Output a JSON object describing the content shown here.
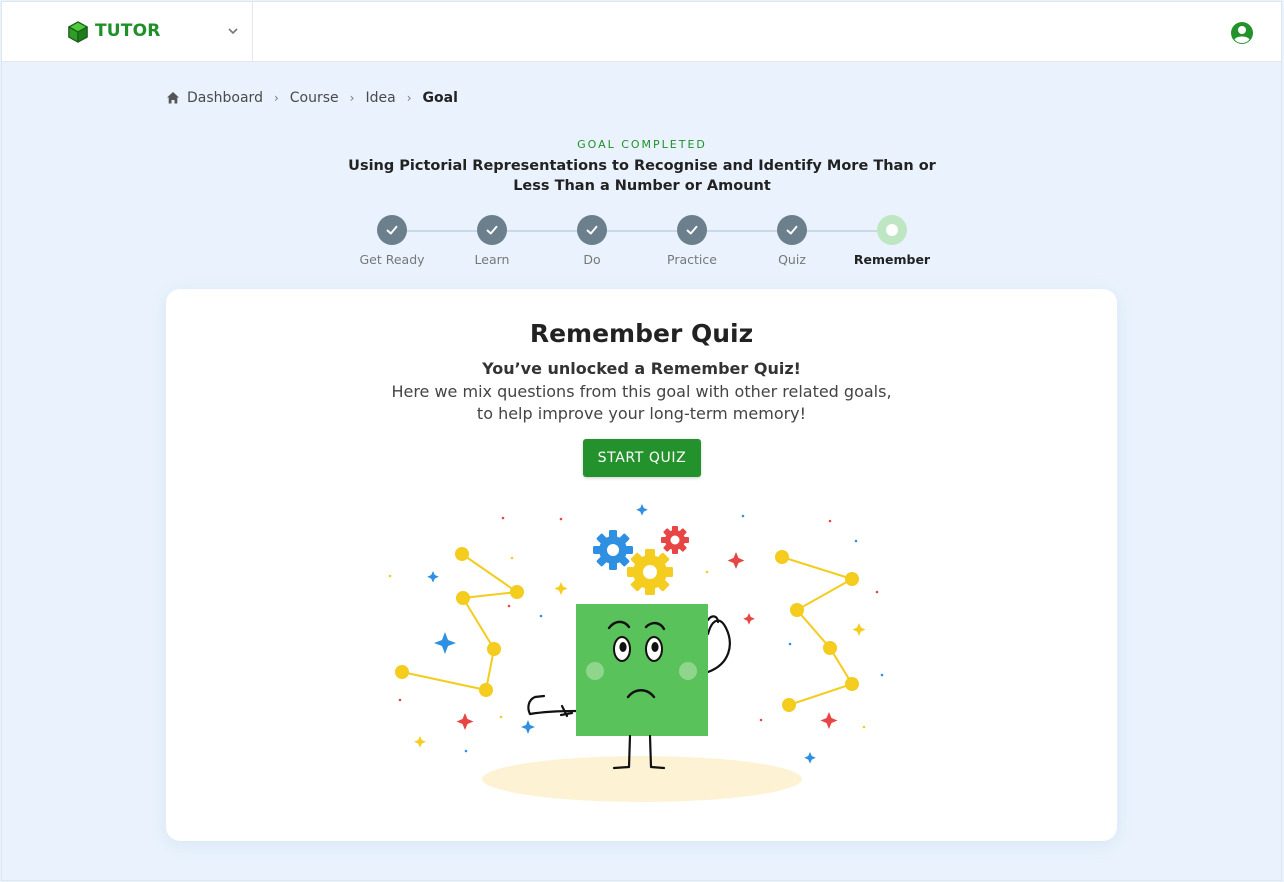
{
  "app": {
    "brand": "TUTOR"
  },
  "icons": {
    "logo": "cube-icon",
    "menu": "chevron-down-icon",
    "account": "account-circle-icon",
    "home": "home-icon",
    "separator": "chevron-right-icon",
    "done": "check-icon"
  },
  "colors": {
    "brand_green": "#23922c",
    "page_bg": "#eaf3fd",
    "step_done": "#6b7f8c",
    "step_current": "#bfe6c3"
  },
  "breadcrumb": [
    {
      "label": "Dashboard"
    },
    {
      "label": "Course"
    },
    {
      "label": "Idea"
    },
    {
      "label": "Goal"
    }
  ],
  "goal": {
    "status": "GOAL COMPLETED",
    "title": "Using Pictorial Representations to Recognise and Identify More Than or Less Than a Number or Amount"
  },
  "steps": [
    {
      "label": "Get Ready",
      "state": "done"
    },
    {
      "label": "Learn",
      "state": "done"
    },
    {
      "label": "Do",
      "state": "done"
    },
    {
      "label": "Practice",
      "state": "done"
    },
    {
      "label": "Quiz",
      "state": "done"
    },
    {
      "label": "Remember",
      "state": "current"
    }
  ],
  "card": {
    "title": "Remember Quiz",
    "subtitle": "You’ve unlocked a Remember Quiz!",
    "body_line1": "Here we mix questions from this goal with other related goals,",
    "body_line2": "to help improve your long-term memory!",
    "button": "START QUIZ"
  }
}
